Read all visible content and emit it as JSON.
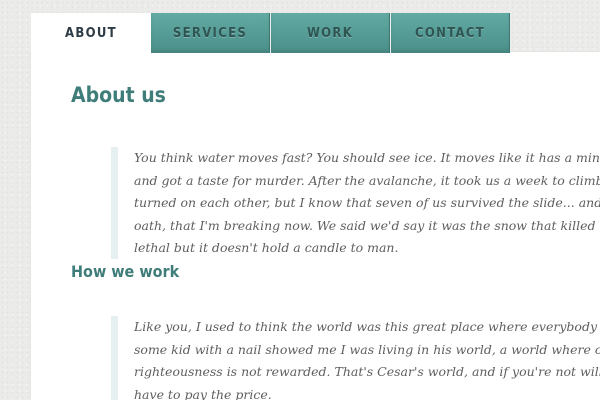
{
  "nav": {
    "tabs": [
      {
        "label": "ABOUT"
      },
      {
        "label": "SERVICES"
      },
      {
        "label": "WORK"
      },
      {
        "label": "CONTACT"
      }
    ]
  },
  "about": {
    "title": "About us",
    "lines": [
      "You think water moves fast? You should see ice. It moves like it has a mind. Like it knows i",
      "and got a taste for murder. After the avalanche, it took us a week to climb out. Now, I don",
      "turned on each other, but I know that seven of us survived the slide... and only five made it",
      "oath, that I'm breaking now. We said we'd say it was the snow that killed the other two, b",
      "lethal but it doesn't hold a candle to man."
    ]
  },
  "how": {
    "title": "How we work",
    "lines": [
      "Like you, I used to think the world was this great place where everybody lived by the same",
      "some kid with a nail showed me I was living in his world, a world where chaos rules not o",
      "righteousness is not rewarded. That's Cesar's world, and if you're not willing to play by his",
      "have to pay the price."
    ]
  }
}
